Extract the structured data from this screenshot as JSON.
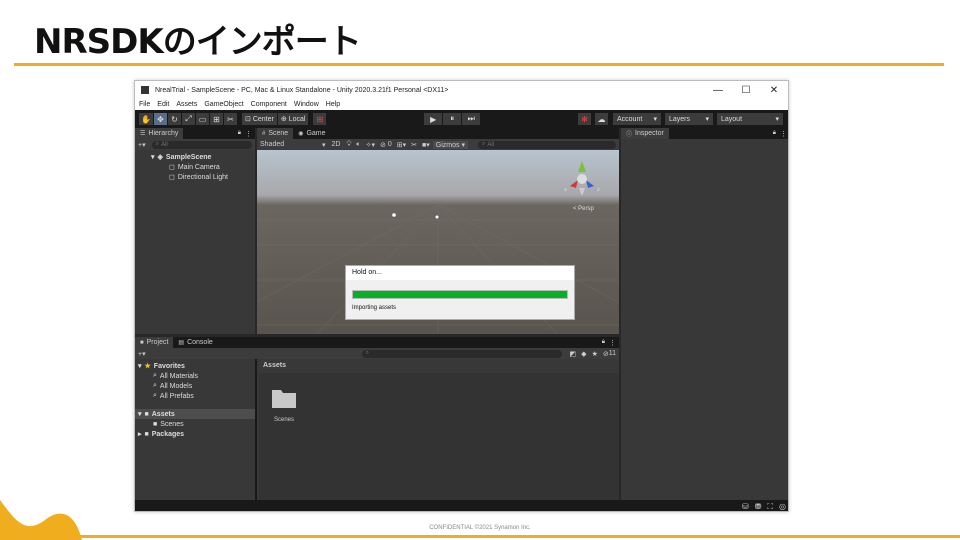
{
  "slide": {
    "title": "NRSDKのインポート",
    "footer": "CONFIDENTIAL  ©2021 Synamon Inc.",
    "accent_color": "#f0ad1e"
  },
  "window": {
    "title": "NrealTrial - SampleScene - PC, Mac & Linux Standalone - Unity 2020.3.21f1 Personal <DX11>",
    "controls": {
      "minimize": "—",
      "maximize": "☐",
      "close": "✕"
    }
  },
  "menu": [
    "File",
    "Edit",
    "Assets",
    "GameObject",
    "Component",
    "Window",
    "Help"
  ],
  "toolbar": {
    "center_label": "Center",
    "local_label": "Local",
    "account_label": "Account",
    "layers_label": "Layers",
    "layout_label": "Layout"
  },
  "hierarchy": {
    "tab_label": "Hierarchy",
    "search_placeholder": "All",
    "scene": "SampleScene",
    "items": [
      "Main Camera",
      "Directional Light"
    ]
  },
  "scene_panel": {
    "tabs": [
      "Scene",
      "Game"
    ],
    "shading": "Shaded",
    "mode_2d": "2D",
    "gizmos_label": "Gizmos",
    "search_placeholder": "All",
    "layers_count": "0",
    "persp_label": "< Persp"
  },
  "dialog": {
    "title": "Hold on...",
    "message": "Importing assets",
    "progress": 1.0,
    "progress_color": "#06b025"
  },
  "inspector": {
    "tab_label": "Inspector"
  },
  "project": {
    "tabs": [
      "Project",
      "Console"
    ],
    "hidden_count": "11",
    "favorites_label": "Favorites",
    "favorites": [
      "All Materials",
      "All Models",
      "All Prefabs"
    ],
    "assets_label": "Assets",
    "assets_children": [
      "Scenes"
    ],
    "packages_label": "Packages",
    "breadcrumb": "Assets",
    "grid_items": [
      {
        "label": "Scenes",
        "icon": "folder-icon"
      }
    ]
  }
}
